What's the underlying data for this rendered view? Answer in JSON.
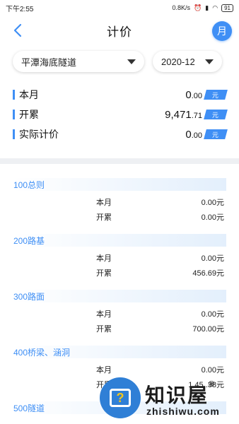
{
  "status_bar": {
    "time": "下午2:55",
    "network_speed": "0.8K/s",
    "battery": "91"
  },
  "header": {
    "title": "计价",
    "month_button": "月"
  },
  "filters": {
    "tunnel": "平潭海底隧道",
    "month": "2020-12"
  },
  "summary": [
    {
      "label": "本月",
      "value_int": "0",
      "value_dec": ".00",
      "unit": "元"
    },
    {
      "label": "开累",
      "value_int": "9,471",
      "value_dec": ".71",
      "unit": "元"
    },
    {
      "label": "实际计价",
      "value_int": "0",
      "value_dec": ".00",
      "unit": "元"
    }
  ],
  "sections": [
    {
      "title": "100总则",
      "rows": [
        {
          "label": "本月",
          "value": "0.00元"
        },
        {
          "label": "开累",
          "value": "0.00元"
        }
      ]
    },
    {
      "title": "200路基",
      "rows": [
        {
          "label": "本月",
          "value": "0.00元"
        },
        {
          "label": "开累",
          "value": "456.69元"
        }
      ]
    },
    {
      "title": "300路面",
      "rows": [
        {
          "label": "本月",
          "value": "0.00元"
        },
        {
          "label": "开累",
          "value": "700.00元"
        }
      ]
    },
    {
      "title": "400桥梁、涵洞",
      "rows": [
        {
          "label": "本月",
          "value": "0.00元"
        },
        {
          "label": "开累",
          "value": "1,45..38元"
        }
      ]
    },
    {
      "title": "500隧道",
      "rows": []
    }
  ],
  "watermark": {
    "text": "知识屋",
    "reg": "®",
    "subtext": "zhishiwu.com"
  },
  "colors": {
    "accent": "#3f8ff5",
    "section_bg": "#e3effc",
    "divider": "#eef0f3"
  }
}
